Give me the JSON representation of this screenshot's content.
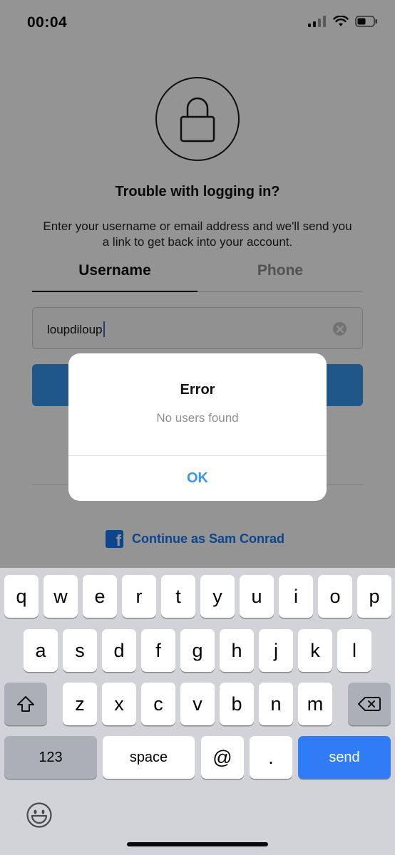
{
  "status_bar": {
    "time": "00:04",
    "icons": [
      "signal-icon",
      "wifi-icon",
      "battery-icon"
    ]
  },
  "screen": {
    "title": "Trouble with logging in?",
    "subtitle": "Enter your username or email address and we'll send you a link to get back into your account.",
    "tabs": [
      {
        "label": "Username",
        "active": true
      },
      {
        "label": "Phone",
        "active": false
      }
    ],
    "username_input": {
      "value": "loupdiloup"
    },
    "facebook_continue": "Continue as Sam Conrad"
  },
  "alert": {
    "title": "Error",
    "message": "No users found",
    "ok_label": "OK"
  },
  "keyboard": {
    "row1": [
      "q",
      "w",
      "e",
      "r",
      "t",
      "y",
      "u",
      "i",
      "o",
      "p"
    ],
    "row2": [
      "a",
      "s",
      "d",
      "f",
      "g",
      "h",
      "j",
      "k",
      "l"
    ],
    "row3": [
      "z",
      "x",
      "c",
      "v",
      "b",
      "n",
      "m"
    ],
    "numbers_label": "123",
    "space_label": "space",
    "at_label": "@",
    "period_label": ".",
    "send_label": "send",
    "icons": [
      "shift-icon",
      "backspace-icon",
      "emoji-icon"
    ]
  },
  "colors": {
    "accent": "#3897f0",
    "facebook": "#1877f2",
    "send_key": "#2f7cf6"
  }
}
